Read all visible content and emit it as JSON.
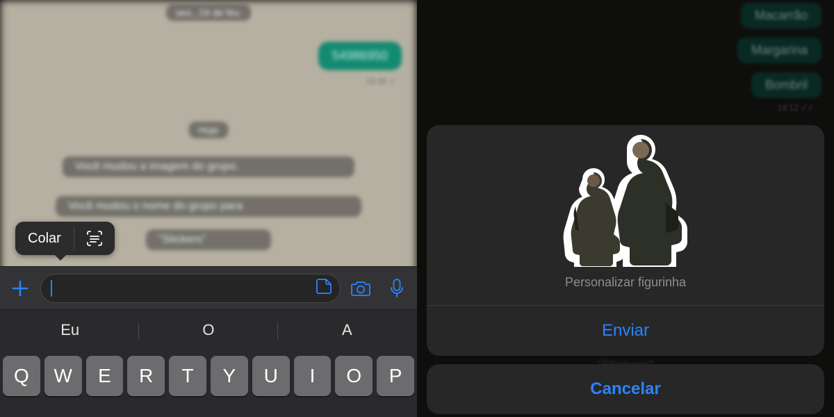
{
  "left": {
    "date_pill_top": "sex., 24 de fev.",
    "outgoing_blur": "54986950",
    "outgoing_meta": "15:30 ✓",
    "date_pill_today": "Hoje",
    "system_msg_1": "Você mudou a imagem do grupo.",
    "system_msg_2": "Você mudou o nome do grupo para",
    "system_msg_3": "\"Stickers\"",
    "popover": {
      "paste": "Colar"
    },
    "suggestions": [
      "Eu",
      "O",
      "A"
    ],
    "keys_row1": [
      "Q",
      "W",
      "E",
      "R",
      "T",
      "Y",
      "U",
      "I",
      "O",
      "P"
    ]
  },
  "right": {
    "bubbles": [
      "Macarrão",
      "Margarina",
      "Bombril"
    ],
    "bubble_meta": "18:12 ✓✓",
    "sheet": {
      "customize": "Personalizar figurinha",
      "send": "Enviar",
      "cancel": "Cancelar"
    },
    "bg_text": "\"Stickers\""
  }
}
